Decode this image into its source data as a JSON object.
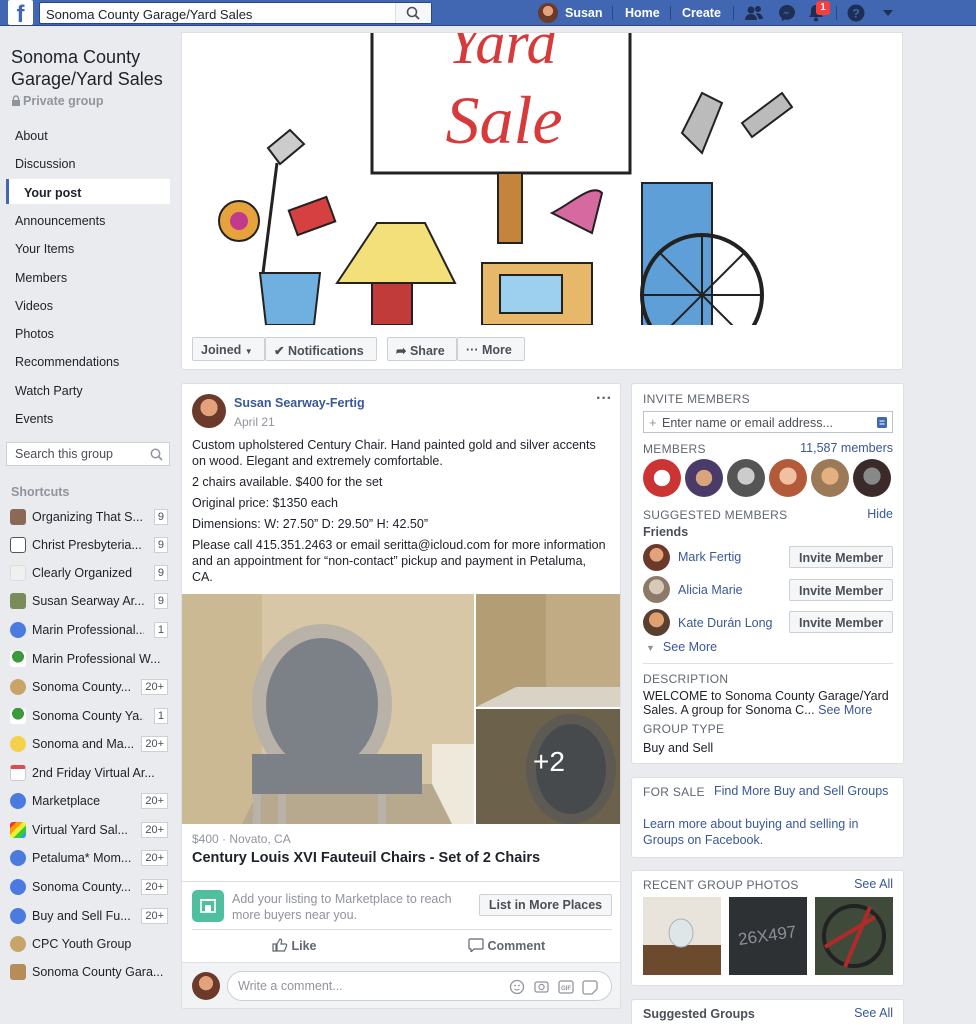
{
  "topbar": {
    "logo": "f",
    "search_value": "Sonoma County Garage/Yard Sales",
    "user_name": "Susan",
    "home": "Home",
    "create": "Create",
    "notif_count": "1",
    "brand_color": "#4267b2"
  },
  "group": {
    "name": "Sonoma County Garage/Yard Sales",
    "privacy": "Private group",
    "nav": [
      "About",
      "Discussion",
      "Your post",
      "Announcements",
      "Your Items",
      "Members",
      "Videos",
      "Photos",
      "Recommendations",
      "Watch Party",
      "Events"
    ],
    "search_placeholder": "Search this group"
  },
  "shortcuts": {
    "heading": "Shortcuts",
    "items": [
      {
        "label": "Organizing That S...",
        "count": "9"
      },
      {
        "label": "Christ Presbyteria...",
        "count": "9"
      },
      {
        "label": "Clearly Organized",
        "count": "9"
      },
      {
        "label": "Susan Searway Ar...",
        "count": "9"
      },
      {
        "label": "Marin Professional...",
        "count": "1"
      },
      {
        "label": "Marin Professional W...",
        "count": ""
      },
      {
        "label": "Sonoma County...",
        "count": "20+"
      },
      {
        "label": "Sonoma County Ya...",
        "count": "1"
      },
      {
        "label": "Sonoma and Ma...",
        "count": "20+"
      },
      {
        "label": "2nd Friday Virtual Ar...",
        "count": ""
      },
      {
        "label": "Marketplace",
        "count": "20+"
      },
      {
        "label": "Virtual Yard Sal...",
        "count": "20+"
      },
      {
        "label": "Petaluma* Mom...",
        "count": "20+"
      },
      {
        "label": "Sonoma County...",
        "count": "20+"
      },
      {
        "label": "Buy and Sell Fu...",
        "count": "20+"
      },
      {
        "label": "CPC Youth Group",
        "count": ""
      },
      {
        "label": "Sonoma County Gara...",
        "count": ""
      }
    ]
  },
  "cover": {
    "sign_text_1": "Yard",
    "sign_text_2": "Sale",
    "actions": {
      "joined": "Joined",
      "notifications": "Notifications",
      "share": "Share",
      "more": "More"
    }
  },
  "post": {
    "author": "Susan Searway-Fertig",
    "date": "April 21",
    "lines": [
      "Custom upholstered Century Chair. Hand painted gold and silver accents on wood. Elegant and extremely comfortable.",
      "2 chairs available. $400 for the set",
      "Original price: $1350 each",
      "Dimensions: W: 27.50” D: 29.50” H: 42.50”",
      "Please call 415.351.2463 or email seritta@icloud.com for more information and an appointment for “non-contact” pickup and payment in Petaluma, CA."
    ],
    "more_photos": "+2",
    "price_location": "$400 · Novato, CA",
    "item_title": "Century Louis XVI Fauteuil Chairs - Set of 2 Chairs",
    "marketplace_prompt": "Add your listing to Marketplace to reach more buyers near you.",
    "list_button": "List in More Places",
    "like": "Like",
    "comment": "Comment",
    "comment_placeholder": "Write a comment..."
  },
  "invite": {
    "heading": "INVITE MEMBERS",
    "placeholder": "Enter name or email address...",
    "members_label": "MEMBERS",
    "members_count": "11,587 members",
    "suggested_label": "SUGGESTED MEMBERS",
    "hide": "Hide",
    "friends": "Friends",
    "suggested": [
      {
        "name": "Mark Fertig",
        "button": "Invite Member"
      },
      {
        "name": "Alicia Marie",
        "button": "Invite Member"
      },
      {
        "name": "Kate Durán Long",
        "button": "Invite Member"
      }
    ],
    "see_more": "See More",
    "description_label": "DESCRIPTION",
    "description": "WELCOME to Sonoma County Garage/Yard Sales. A group for Sonoma C...",
    "description_more": "See More",
    "group_type_label": "GROUP TYPE",
    "group_type": "Buy and Sell"
  },
  "forsale": {
    "label": "FOR SALE",
    "find_link": "Find More Buy and Sell Groups",
    "learn_link": "Learn more about buying and selling in Groups on Facebook."
  },
  "photos_card": {
    "label": "RECENT GROUP PHOTOS",
    "see_all": "See All",
    "tire_text": "26X497"
  },
  "suggested_groups": {
    "label": "Suggested Groups",
    "see_all": "See All"
  }
}
